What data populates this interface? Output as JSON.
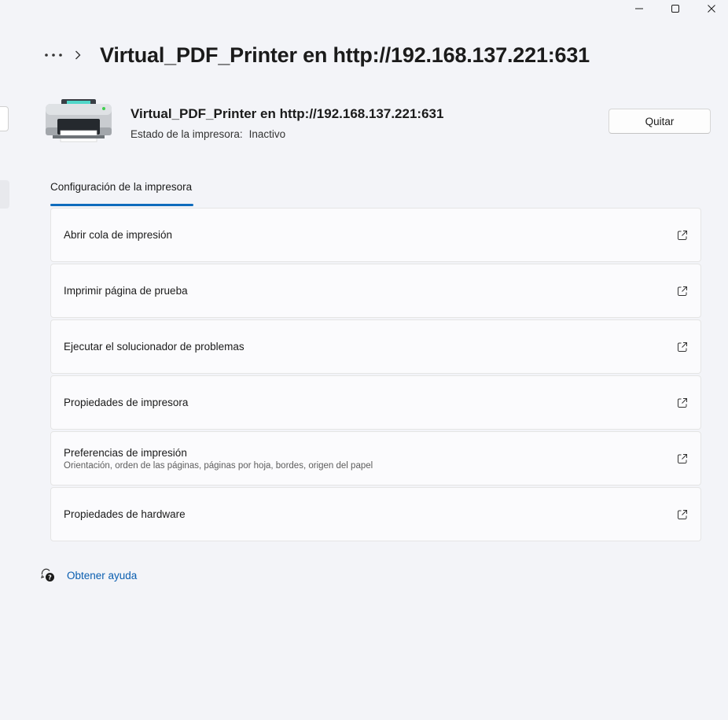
{
  "window": {
    "controls": {
      "minimize_icon": "minimize-icon",
      "maximize_icon": "maximize-icon",
      "close_icon": "close-icon"
    }
  },
  "breadcrumb": {
    "more_icon": "more-horizontal-icon",
    "separator_icon": "chevron-right-icon",
    "title": "Virtual_PDF_Printer en http://192.168.137.221:631"
  },
  "printer": {
    "icon": "printer-icon",
    "name": "Virtual_PDF_Printer en http://192.168.137.221:631",
    "status_label": "Estado de la impresora:",
    "status_value": "Inactivo",
    "remove_label": "Quitar"
  },
  "tabs": [
    {
      "label": "Configuración de la impresora",
      "selected": true
    }
  ],
  "settings": [
    {
      "label": "Abrir cola de impresión",
      "description": "",
      "icon": "open-external-icon"
    },
    {
      "label": "Imprimir página de prueba",
      "description": "",
      "icon": "open-external-icon"
    },
    {
      "label": "Ejecutar el solucionador de problemas",
      "description": "",
      "icon": "open-external-icon"
    },
    {
      "label": "Propiedades de impresora",
      "description": "",
      "icon": "open-external-icon"
    },
    {
      "label": "Preferencias de impresión",
      "description": "Orientación, orden de las páginas, páginas por hoja, bordes, origen del papel",
      "icon": "open-external-icon"
    },
    {
      "label": "Propiedades de hardware",
      "description": "",
      "icon": "open-external-icon"
    }
  ],
  "help": {
    "icon": "get-help-icon",
    "label": "Obtener ayuda"
  },
  "colors": {
    "accent": "#0f6cbd",
    "link": "#0a5eb0",
    "background": "#f3f4f8"
  }
}
